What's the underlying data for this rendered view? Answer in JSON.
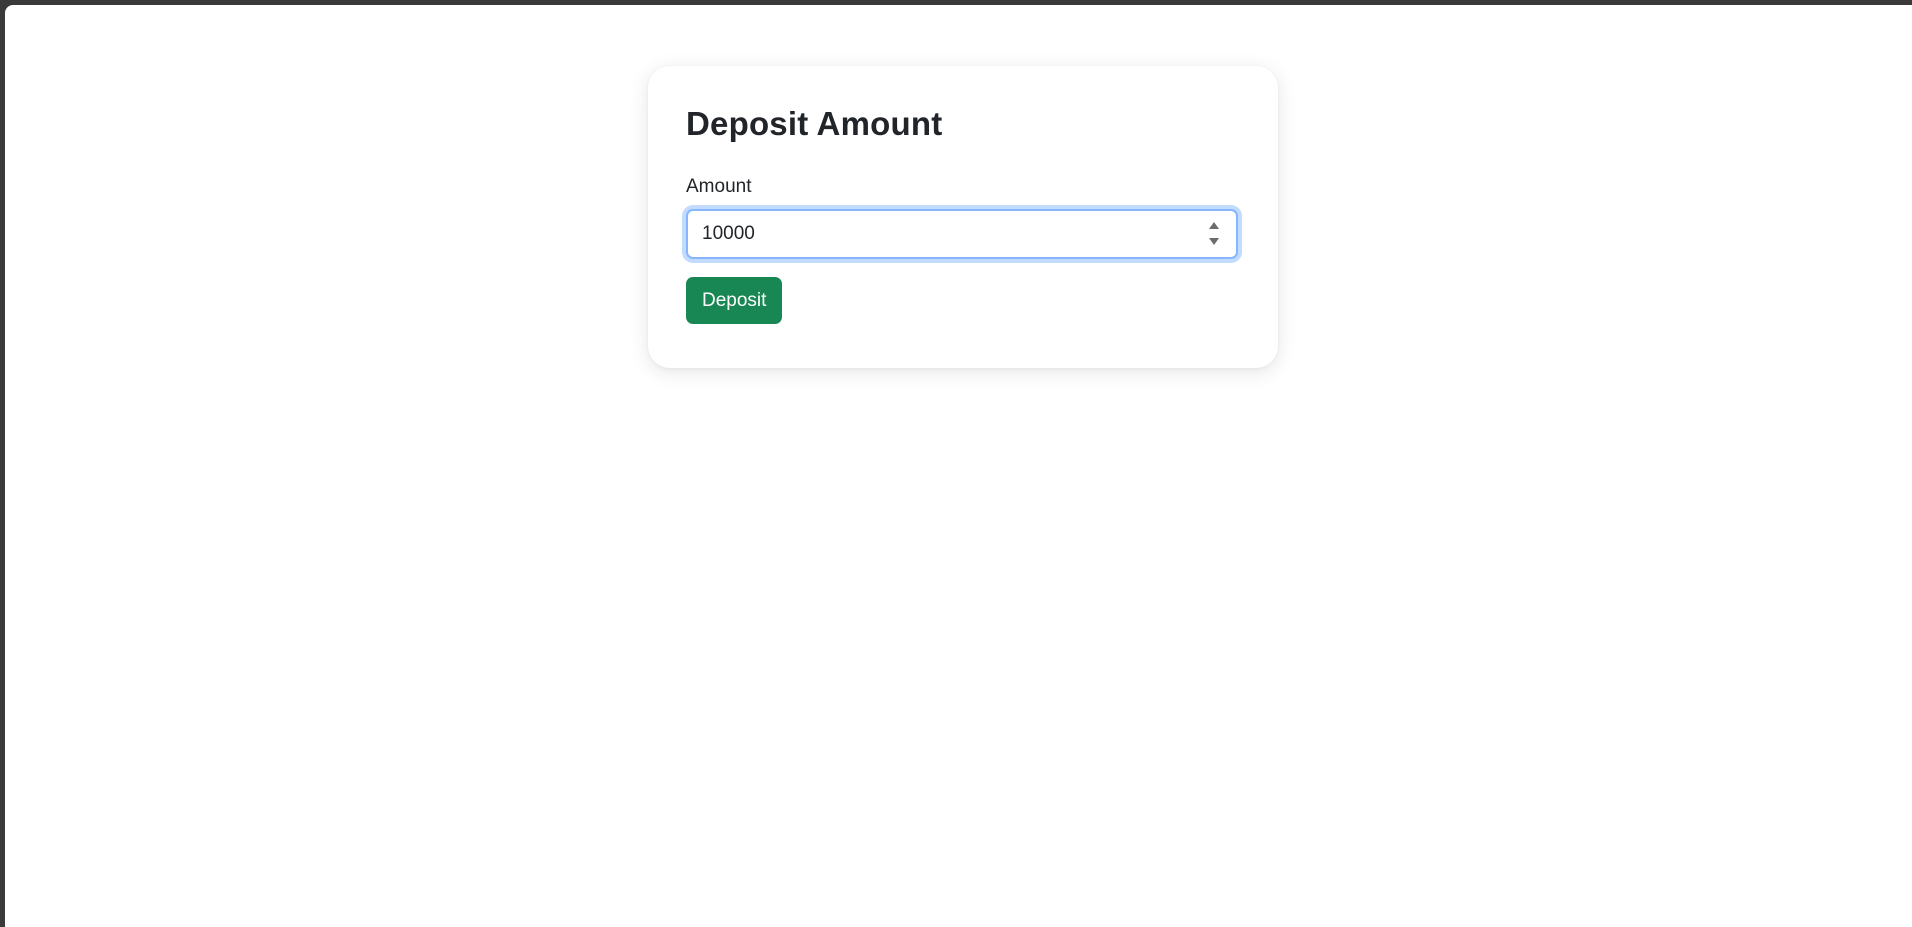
{
  "colors": {
    "window_frame": "#3a3a3a",
    "background": "#ffffff",
    "text": "#212529",
    "focus_border": "#86b7fe",
    "button_bg": "#198754",
    "button_text": "#ffffff"
  },
  "form": {
    "title": "Deposit Amount",
    "amount_label": "Amount",
    "amount_value": "10000",
    "input_type": "number",
    "submit_label": "Deposit"
  },
  "icons": {
    "spin_up": "spinner-up-icon",
    "spin_down": "spinner-down-icon"
  }
}
